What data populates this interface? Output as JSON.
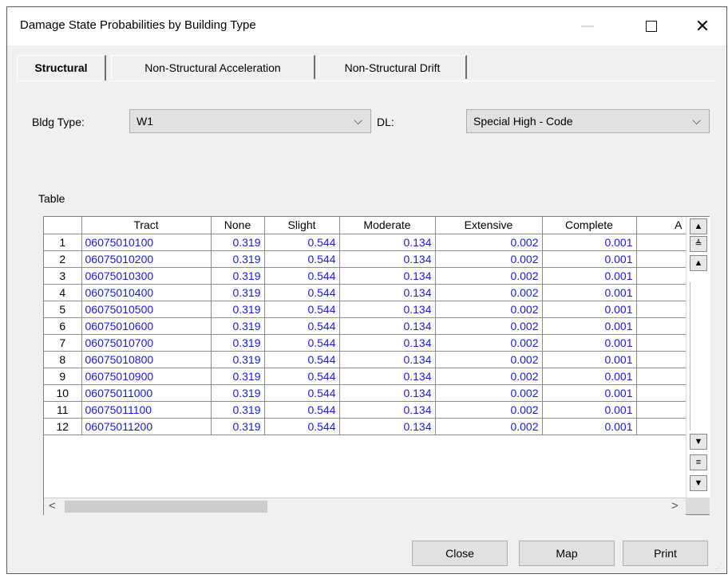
{
  "window": {
    "title": "Damage State Probabilities by Building Type"
  },
  "tabs": [
    {
      "label": "Structural",
      "active": true
    },
    {
      "label": "Non-Structural Acceleration",
      "active": false
    },
    {
      "label": "Non-Structural Drift",
      "active": false
    }
  ],
  "filters": {
    "bldg_type_label": "Bldg Type:",
    "bldg_type_value": "W1",
    "dl_label": "DL:",
    "dl_value": "Special High - Code"
  },
  "table": {
    "label": "Table",
    "columns": [
      "",
      "Tract",
      "None",
      "Slight",
      "Moderate",
      "Extensive",
      "Complete",
      "A"
    ],
    "rows": [
      [
        "1",
        "06075010100",
        "0.319",
        "0.544",
        "0.134",
        "0.002",
        "0.001"
      ],
      [
        "2",
        "06075010200",
        "0.319",
        "0.544",
        "0.134",
        "0.002",
        "0.001"
      ],
      [
        "3",
        "06075010300",
        "0.319",
        "0.544",
        "0.134",
        "0.002",
        "0.001"
      ],
      [
        "4",
        "06075010400",
        "0.319",
        "0.544",
        "0.134",
        "0.002",
        "0.001"
      ],
      [
        "5",
        "06075010500",
        "0.319",
        "0.544",
        "0.134",
        "0.002",
        "0.001"
      ],
      [
        "6",
        "06075010600",
        "0.319",
        "0.544",
        "0.134",
        "0.002",
        "0.001"
      ],
      [
        "7",
        "06075010700",
        "0.319",
        "0.544",
        "0.134",
        "0.002",
        "0.001"
      ],
      [
        "8",
        "06075010800",
        "0.319",
        "0.544",
        "0.134",
        "0.002",
        "0.001"
      ],
      [
        "9",
        "06075010900",
        "0.319",
        "0.544",
        "0.134",
        "0.002",
        "0.001"
      ],
      [
        "10",
        "06075011000",
        "0.319",
        "0.544",
        "0.134",
        "0.002",
        "0.001"
      ],
      [
        "11",
        "06075011100",
        "0.319",
        "0.544",
        "0.134",
        "0.002",
        "0.001"
      ],
      [
        "12",
        "06075011200",
        "0.319",
        "0.544",
        "0.134",
        "0.002",
        "0.001"
      ]
    ]
  },
  "buttons": {
    "close": "Close",
    "map": "Map",
    "print": "Print"
  },
  "icons": {
    "window_close": "✕",
    "minimize": "—",
    "combo_arrow": "⌵",
    "scroll_top": "▲",
    "page_up": "≜",
    "line_up": "▲",
    "line_down": "▼",
    "page_down": "≡",
    "scroll_bottom": "▼",
    "scroll_left": "<",
    "scroll_right": ">"
  },
  "colors": {
    "cell_text": "#1a1adb",
    "window_bg": "#f0f0f0"
  }
}
